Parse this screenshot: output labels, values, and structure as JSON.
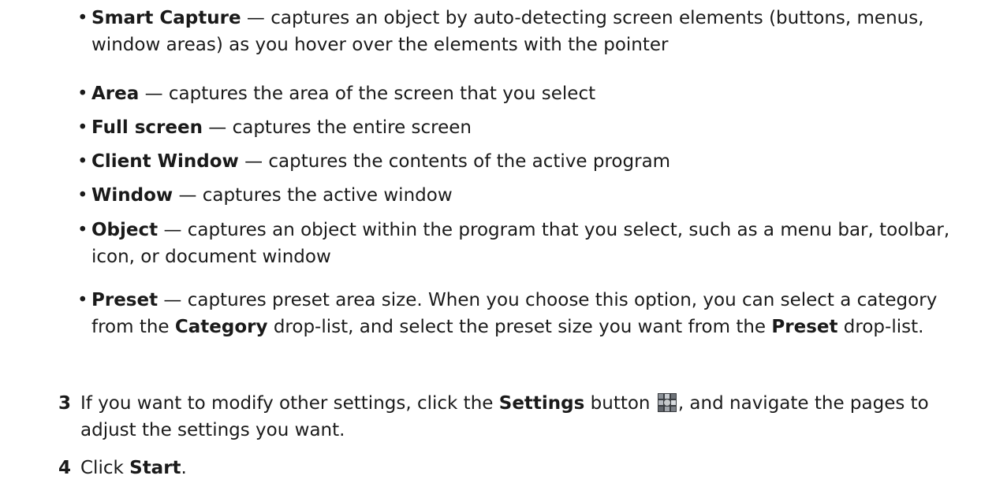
{
  "bullet_glyph": "•",
  "capture_modes": [
    {
      "name": "Smart Capture",
      "sep": "  — ",
      "desc": "captures an object by auto-detecting screen elements (buttons, menus, window areas) as you hover over the elements with the pointer"
    },
    {
      "name": "Area",
      "sep": " — ",
      "desc": "captures the area of the screen that you select"
    },
    {
      "name": "Full screen",
      "sep": " — ",
      "desc": "captures the entire screen"
    },
    {
      "name": "Client Window",
      "sep": " — ",
      "desc": "captures the contents of the active program"
    },
    {
      "name": "Window",
      "sep": " — ",
      "desc": "captures the active window"
    },
    {
      "name": "Object",
      "sep": " — ",
      "desc": "captures an object within the program that you select, such as a menu bar, toolbar, icon, or document window"
    },
    {
      "name": "Preset",
      "sep": " — ",
      "desc_1": "captures preset area size. When you choose this option, you can select a category from the ",
      "bold_1": "Category",
      "desc_2": " drop-list, and select the preset size you want from the ",
      "bold_2": "Preset",
      "desc_3": " drop-list."
    }
  ],
  "steps": [
    {
      "number": "3",
      "text_1": "If you want to modify other settings, click the ",
      "bold_1": "Settings",
      "text_2": " button ",
      "icon": "settings-icon",
      "text_3": ", and navigate the pages to adjust the settings you want."
    },
    {
      "number": "4",
      "text_1": "Click ",
      "bold_1": "Start",
      "text_2": "."
    }
  ]
}
